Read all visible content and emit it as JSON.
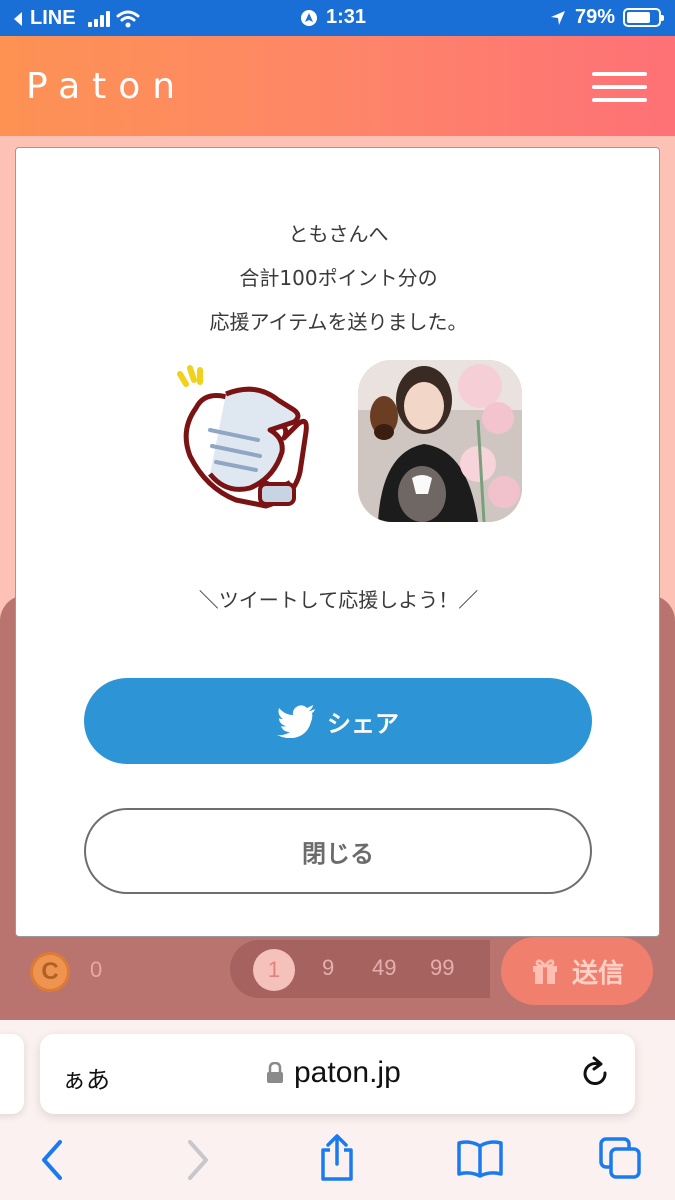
{
  "status_bar": {
    "back_app": "LINE",
    "time": "1:31",
    "battery": "79%"
  },
  "header": {
    "logo": "Paton"
  },
  "modal": {
    "message_lines": [
      "ともさんへ",
      "合計100ポイント分の",
      "応援アイテムを送りました。"
    ],
    "cta": "＼ツイートして応援しよう！／",
    "share_label": "シェア",
    "close_label": "閉じる"
  },
  "bottom_bar": {
    "coin_label": "C",
    "coin_count": "0",
    "amounts": [
      "1",
      "9",
      "49",
      "99"
    ],
    "selected_amount": "1",
    "send_label": "送信"
  },
  "browser": {
    "aa": "ぁあ",
    "url": "paton.jp"
  },
  "colors": {
    "status_bar": "#1a6fd6",
    "header_start": "#fd9253",
    "header_end": "#fe7177",
    "share_button": "#2d95d5",
    "send_button": "#f07f6e"
  }
}
